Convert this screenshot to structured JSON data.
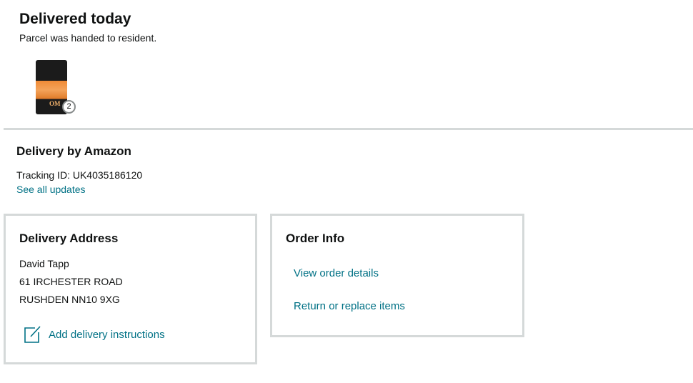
{
  "status": {
    "title": "Delivered today",
    "subtitle": "Parcel was handed to resident."
  },
  "product": {
    "image_icon": "dog-food-bag-thumbnail",
    "label_text": "OM",
    "quantity": "2"
  },
  "shipment": {
    "carrier_title": "Delivery by Amazon",
    "tracking": "Tracking ID: UK4035186120",
    "updates_link": "See all updates"
  },
  "address_card": {
    "title": "Delivery Address",
    "name": "David Tapp",
    "line1": "61 IRCHESTER ROAD",
    "line2": "RUSHDEN NN10 9XG",
    "instructions_icon": "edit-note-icon",
    "instructions_label": "Add delivery instructions"
  },
  "order_card": {
    "title": "Order Info",
    "view_details": "View order details",
    "return_items": "Return or replace items"
  },
  "colors": {
    "link": "#007185",
    "border": "#d5d9d9",
    "text": "#0f1111"
  }
}
